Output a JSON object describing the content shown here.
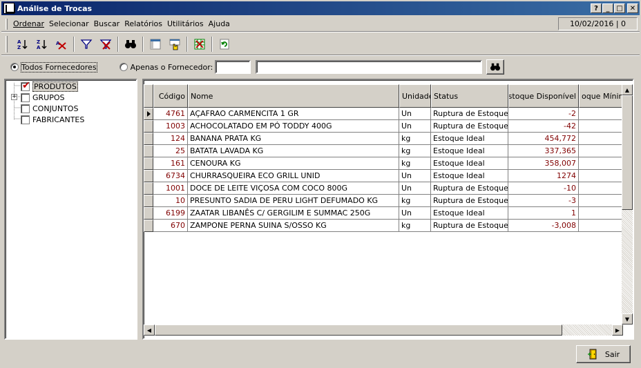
{
  "window": {
    "title": "Análise de Trocas",
    "controls": {
      "help": "?",
      "minimize": "_",
      "maximize": "□",
      "close": "✕"
    }
  },
  "menu": {
    "items": [
      "Ordenar",
      "Selecionar",
      "Buscar",
      "Relatórios",
      "Utilitários",
      "Ajuda"
    ],
    "status_date": "10/02/2016 | 0"
  },
  "toolbar": {
    "icons": [
      "sort-ascending-icon",
      "sort-descending-icon",
      "clear-sort-icon",
      "filter-icon",
      "clear-filter-icon",
      "binoculars-icon",
      "column-layout-icon",
      "hand-select-icon",
      "export-icon",
      "refresh-icon"
    ]
  },
  "filter": {
    "all_label": "Todos Fornecedores",
    "only_label": "Apenas o Fornecedor:",
    "supplier_code": "",
    "supplier_name": ""
  },
  "tree": {
    "items": [
      {
        "label": "PRODUTOS",
        "checked": true,
        "expandable": false,
        "selected": true
      },
      {
        "label": "GRUPOS",
        "checked": false,
        "expandable": true,
        "selected": false
      },
      {
        "label": "CONJUNTOS",
        "checked": false,
        "expandable": false,
        "selected": false
      },
      {
        "label": "FABRICANTES",
        "checked": false,
        "expandable": false,
        "selected": false
      }
    ]
  },
  "grid": {
    "columns": [
      "Código",
      "Nome",
      "Unidade",
      "Status",
      "Estoque Disponível",
      "oque Mínimo"
    ],
    "rows": [
      {
        "codigo": "4761",
        "nome": "AÇAFRAO CARMENCITA 1 GR",
        "unidade": "Un",
        "status": "Ruptura de Estoque",
        "estoque": "-2",
        "minimo": ""
      },
      {
        "codigo": "1003",
        "nome": "ACHOCOLATADO EM PÓ TODDY 400G",
        "unidade": "Un",
        "status": "Ruptura de Estoque",
        "estoque": "-42",
        "minimo": ""
      },
      {
        "codigo": "124",
        "nome": "BANANA PRATA KG",
        "unidade": "kg",
        "status": "Estoque Ideal",
        "estoque": "454,772",
        "minimo": ""
      },
      {
        "codigo": "25",
        "nome": "BATATA LAVADA KG",
        "unidade": "kg",
        "status": "Estoque Ideal",
        "estoque": "337,365",
        "minimo": ""
      },
      {
        "codigo": "161",
        "nome": "CENOURA KG",
        "unidade": "kg",
        "status": "Estoque Ideal",
        "estoque": "358,007",
        "minimo": ""
      },
      {
        "codigo": "6734",
        "nome": "CHURRASQUEIRA ECO GRILL UNID",
        "unidade": "Un",
        "status": "Estoque Ideal",
        "estoque": "1274",
        "minimo": ""
      },
      {
        "codigo": "1001",
        "nome": "DOCE DE LEITE VIÇOSA COM COCO 800G",
        "unidade": "Un",
        "status": "Ruptura de Estoque",
        "estoque": "-10",
        "minimo": ""
      },
      {
        "codigo": "10",
        "nome": "PRESUNTO SADIA DE PERU LIGHT DEFUMADO KG",
        "unidade": "kg",
        "status": "Ruptura de Estoque",
        "estoque": "-3",
        "minimo": ""
      },
      {
        "codigo": "6199",
        "nome": "ZAATAR LIBANÊS C/ GERGILIM E SUMMAC 250G",
        "unidade": "Un",
        "status": "Estoque Ideal",
        "estoque": "1",
        "minimo": ""
      },
      {
        "codigo": "670",
        "nome": "ZAMPONE PERNA SUINA S/OSSO KG",
        "unidade": "kg",
        "status": "Ruptura de Estoque",
        "estoque": "-3,008",
        "minimo": ""
      }
    ]
  },
  "footer": {
    "exit_label": "Sair"
  },
  "colors": {
    "title_start": "#0a246a",
    "title_end": "#3a6ea5",
    "code_red": "#800000",
    "check_red": "#c00000",
    "face": "#d4d0c8"
  }
}
